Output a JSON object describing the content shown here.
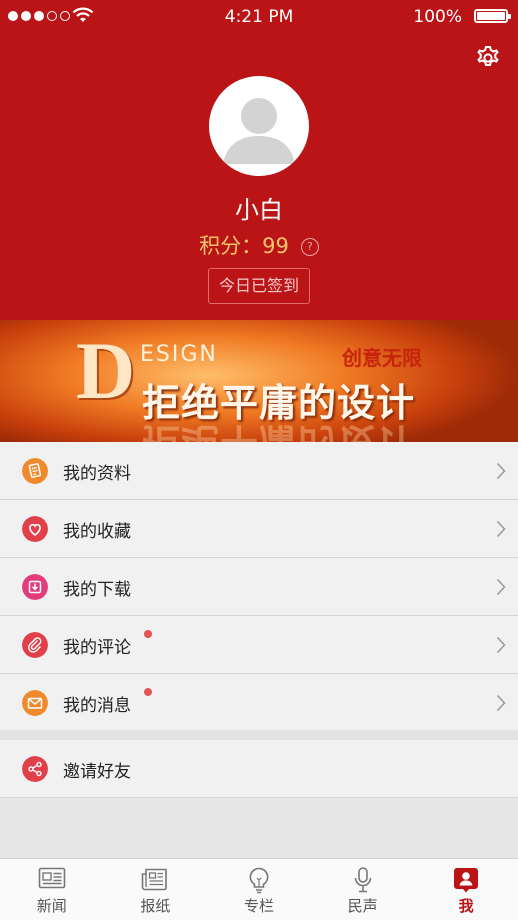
{
  "status_bar": {
    "time": "4:21 PM",
    "battery": "100%",
    "icons": [
      "signal-icon",
      "wifi-icon",
      "battery-icon"
    ]
  },
  "profile": {
    "username": "小白",
    "points_label": "积分：",
    "points_value": "99",
    "help_glyph": "?",
    "checkin_label": "今日已签到"
  },
  "banner": {
    "big_letter": "D",
    "esign": "ESIGN",
    "tag": "创意无限",
    "slogan": "拒绝平庸的设计"
  },
  "menu": {
    "items": [
      {
        "label": "我的资料",
        "icon": "profile-doc-icon",
        "color": "#ef8a2c",
        "badge": false
      },
      {
        "label": "我的收藏",
        "icon": "heart-icon",
        "color": "#e0404a",
        "badge": false
      },
      {
        "label": "我的下载",
        "icon": "download-icon",
        "color": "#e23c7a",
        "badge": false
      },
      {
        "label": "我的评论",
        "icon": "paperclip-icon",
        "color": "#e0404a",
        "badge": true
      },
      {
        "label": "我的消息",
        "icon": "envelope-icon",
        "color": "#ef8a2c",
        "badge": true
      }
    ],
    "invite": {
      "label": "邀请好友",
      "icon": "share-icon",
      "color": "#e0404a"
    }
  },
  "tabbar": {
    "tabs": [
      {
        "label": "新闻",
        "icon": "news-icon",
        "active": false
      },
      {
        "label": "报纸",
        "icon": "newspaper-icon",
        "active": false
      },
      {
        "label": "专栏",
        "icon": "lightbulb-icon",
        "active": false
      },
      {
        "label": "民声",
        "icon": "microphone-icon",
        "active": false
      },
      {
        "label": "我",
        "icon": "user-profile-icon",
        "active": true
      }
    ]
  },
  "colors": {
    "brand_red": "#bb1417",
    "points_gold": "#f4c56a",
    "badge_red": "#e25555"
  }
}
